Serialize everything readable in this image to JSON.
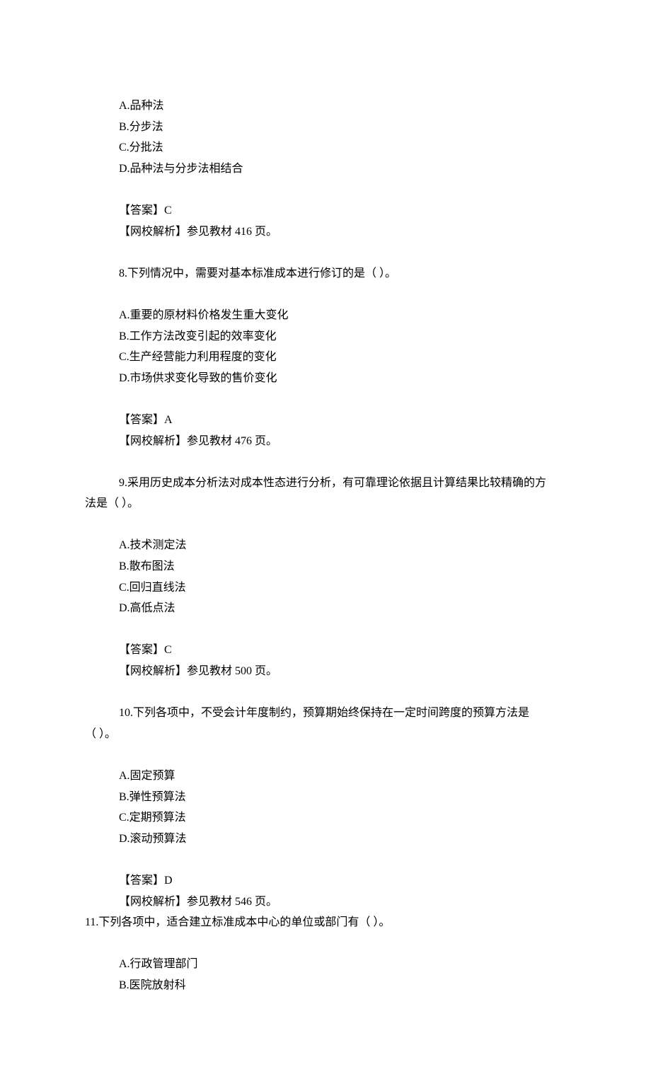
{
  "q7": {
    "options": {
      "A": "A.品种法",
      "B": "B.分步法",
      "C": "C.分批法",
      "D": "D.品种法与分步法相结合"
    },
    "answer_label": "【答案】C",
    "analysis_label": "【网校解析】参见教材 416 页。"
  },
  "q8": {
    "question": "8.下列情况中，需要对基本标准成本进行修订的是（  ）。",
    "options": {
      "A": "A.重要的原材料价格发生重大变化",
      "B": "B.工作方法改变引起的效率变化",
      "C": "C.生产经营能力利用程度的变化",
      "D": "D.市场供求变化导致的售价变化"
    },
    "answer_label": "【答案】A",
    "analysis_label": "【网校解析】参见教材 476 页。"
  },
  "q9": {
    "question_line1": "9.采用历史成本分析法对成本性态进行分析，有可靠理论依据且计算结果比较精确的方",
    "question_line2": "法是（  ）。",
    "options": {
      "A": "A.技术测定法",
      "B": "B.散布图法",
      "C": "C.回归直线法",
      "D": "D.高低点法"
    },
    "answer_label": "【答案】C",
    "analysis_label": "【网校解析】参见教材 500 页。"
  },
  "q10": {
    "question_line1": "10.下列各项中，不受会计年度制约，预算期始终保持在一定时间跨度的预算方法是",
    "question_line2": "（  ）。",
    "options": {
      "A": "A.固定预算",
      "B": "B.弹性预算法",
      "C": "C.定期预算法",
      "D": "D.滚动预算法"
    },
    "answer_label": "【答案】D",
    "analysis_label": "【网校解析】参见教材 546 页。"
  },
  "q11": {
    "question": "11.下列各项中，适合建立标准成本中心的单位或部门有（  ）。",
    "options": {
      "A": "A.行政管理部门",
      "B": "B.医院放射科"
    }
  }
}
